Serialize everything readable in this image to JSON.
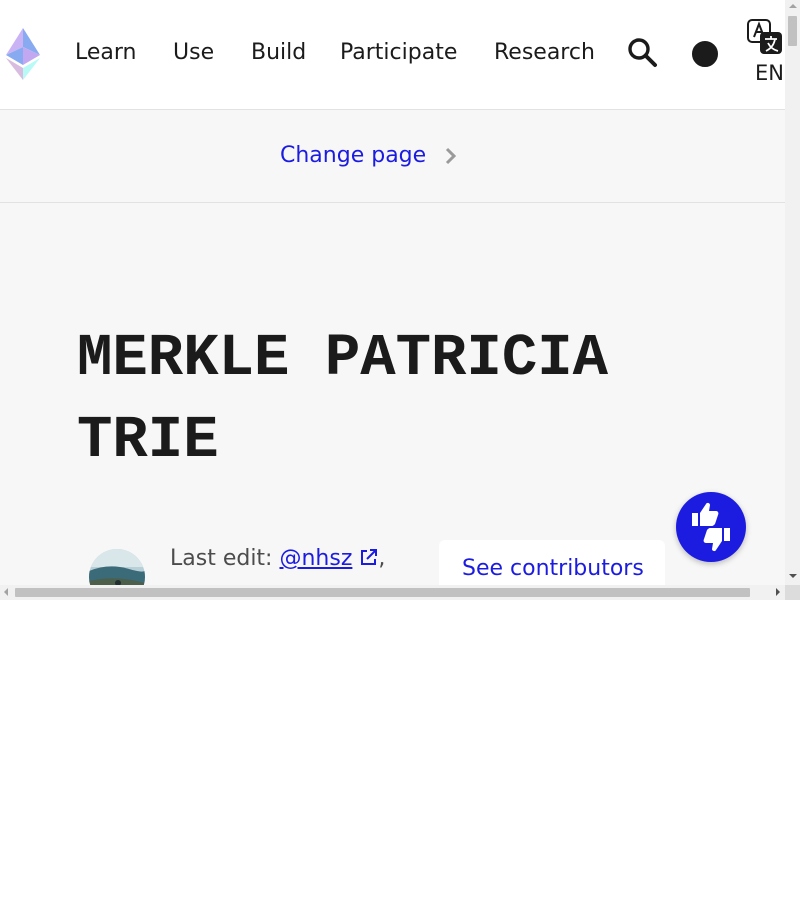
{
  "header": {
    "nav": [
      {
        "label": "Learn"
      },
      {
        "label": "Use"
      },
      {
        "label": "Build"
      },
      {
        "label": "Participate"
      },
      {
        "label": "Research"
      }
    ],
    "icons": {
      "logo": "ethereum-logo-icon",
      "search": "search-icon",
      "theme": "dark-mode-toggle-icon",
      "language": "translate-icon"
    },
    "language_label": "EN"
  },
  "change_page": {
    "label": "Change page",
    "icon": "chevron-right-icon"
  },
  "main": {
    "title": "Merkle Patricia Trie",
    "last_edit_label": "Last edit:",
    "last_edit_user": "@nhsz",
    "last_edit_suffix": ",",
    "contributors_button": "See contributors"
  },
  "feedback": {
    "icon": "thumbs-up-down-icon"
  },
  "colors": {
    "accent": "#1c1ce1",
    "text": "#1b1b1b",
    "background": "#f7f7f7",
    "header_bg": "#ffffff"
  }
}
